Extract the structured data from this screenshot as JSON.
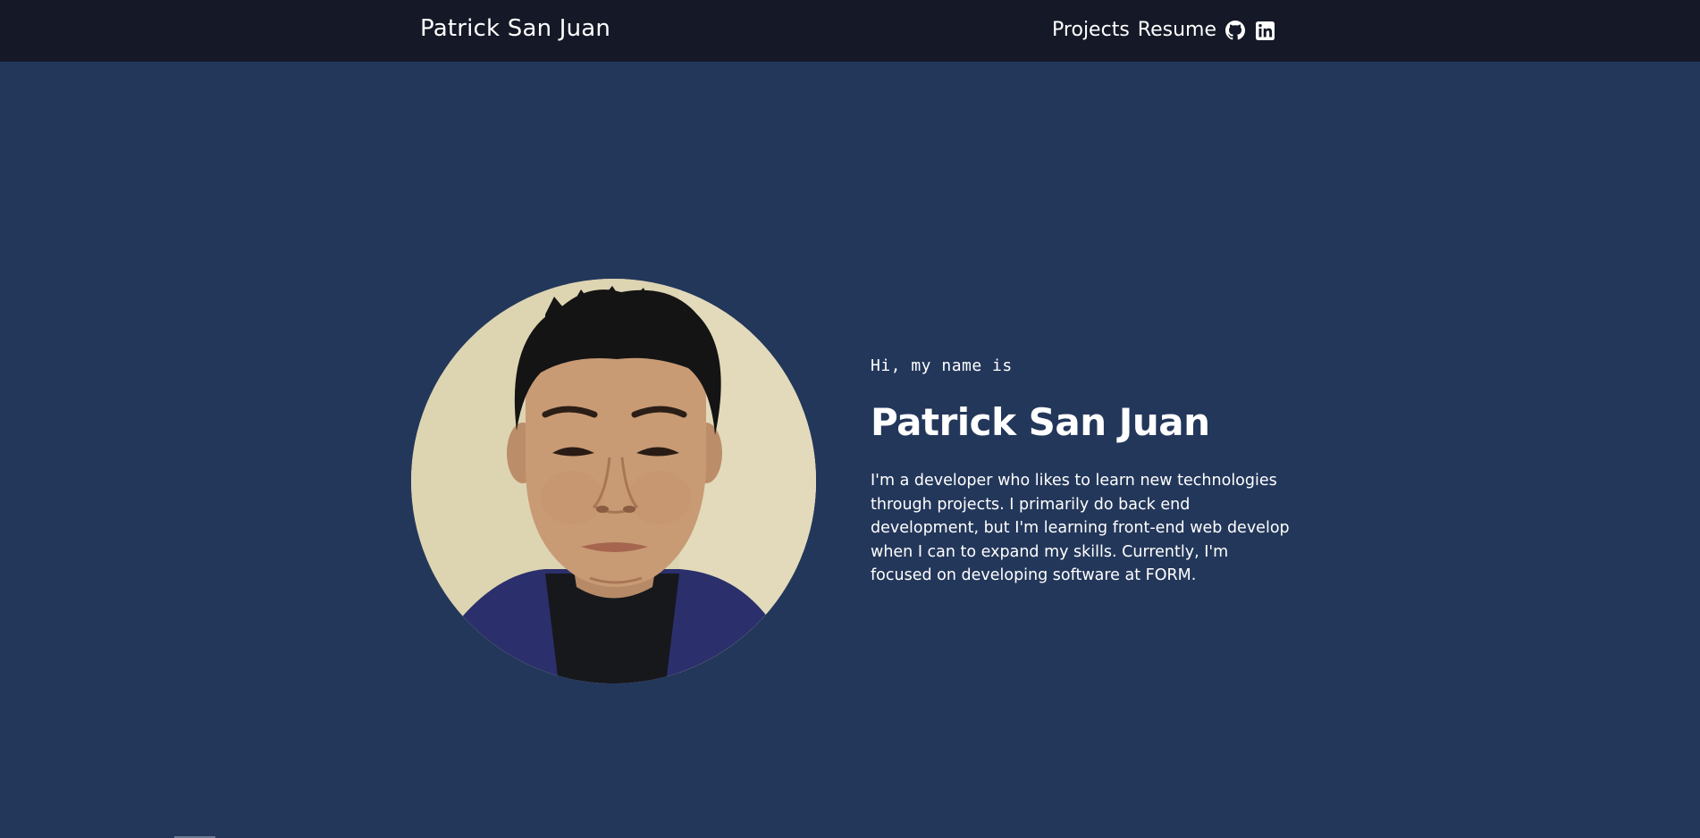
{
  "navbar": {
    "brand": "Patrick San Juan",
    "links": [
      {
        "label": "Projects"
      },
      {
        "label": "Resume"
      }
    ],
    "icons": [
      {
        "name": "github-icon"
      },
      {
        "name": "linkedin-icon"
      }
    ]
  },
  "hero": {
    "avatar_icon": "profile-photo",
    "greeting": "Hi, my name is",
    "name": "Patrick San Juan",
    "bio": "I'm a developer who likes to learn new technologies through projects. I primarily do back end development, but I'm learning front-end web develop when I can to expand my skills. Currently, I'm focused on developing software at FORM."
  },
  "colors": {
    "navbar_bg": "#151826",
    "page_bg": "#23375a",
    "text": "#ffffff"
  }
}
